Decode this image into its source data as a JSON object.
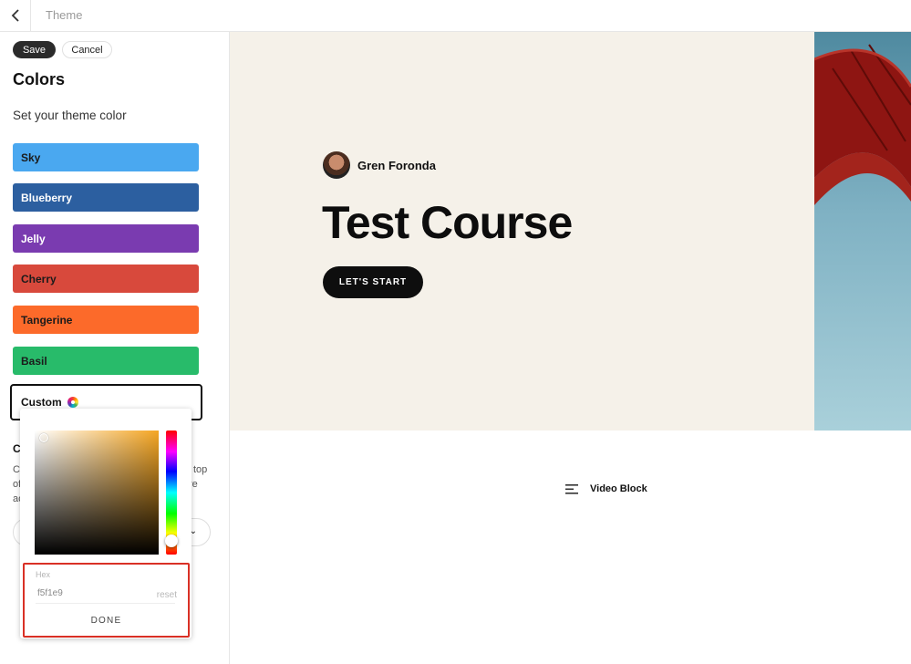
{
  "topbar": {
    "title": "Theme",
    "back_icon": "chevron-left-icon"
  },
  "sidebar": {
    "save_label": "Save",
    "cancel_label": "Cancel",
    "heading": "Colors",
    "subheading": "Set your theme color",
    "swatches": [
      {
        "label": "Sky",
        "color": "#4aa8f0"
      },
      {
        "label": "Blueberry",
        "color": "#2c5fa0"
      },
      {
        "label": "Jelly",
        "color": "#7a3bb0"
      },
      {
        "label": "Cherry",
        "color": "#d8493c"
      },
      {
        "label": "Tangerine",
        "color": "#fc6a2a"
      },
      {
        "label": "Basil",
        "color": "#28bb6a"
      }
    ],
    "custom": {
      "label": "Custom",
      "icon": "color-wheel-icon"
    },
    "partial": {
      "heading_char": "C",
      "line1_start": "C",
      "line1_end": "top",
      "line2_start": "of",
      "line2_end": "re",
      "line3_start": "ac"
    }
  },
  "picker": {
    "hex_label": "Hex",
    "hex_value": "f5f1e9",
    "reset_label": "reset",
    "done_label": "DONE"
  },
  "preview": {
    "author": "Gren Foronda",
    "title": "Test Course",
    "cta": "LET'S START",
    "block_label": "Video Block",
    "block_icon": "text-align-icon",
    "hero_bg": "#f5f1e9"
  }
}
